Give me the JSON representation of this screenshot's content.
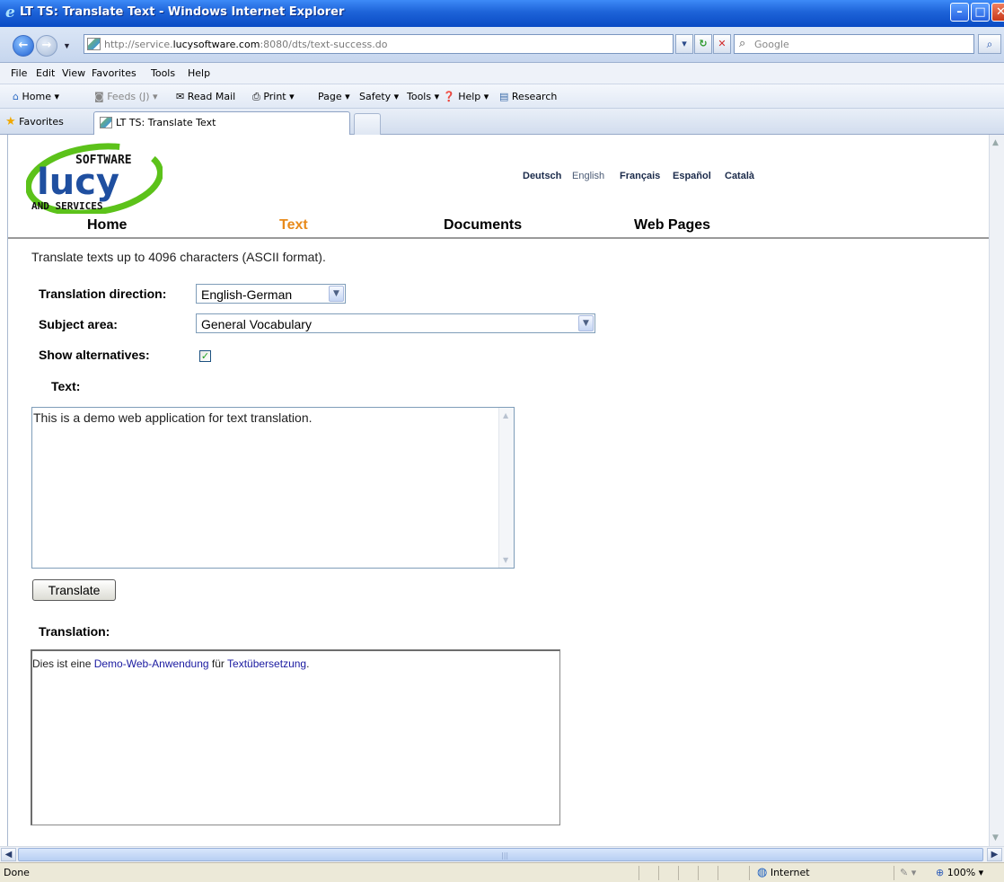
{
  "window": {
    "title": "LT TS: Translate Text - Windows Internet Explorer",
    "min_glyph": "–",
    "max_glyph": "□",
    "close_glyph": "✕"
  },
  "address_bar": {
    "url_prefix": "http://service.",
    "url_domain": "lucysoftware.com",
    "url_suffix": ":8080/dts/text-success.do",
    "search_placeholder": "Google"
  },
  "menu": [
    "File",
    "Edit",
    "View",
    "Favorites",
    "Tools",
    "Help"
  ],
  "command_bar": {
    "home": "Home ▾",
    "feeds": "Feeds (J) ▾",
    "read_mail": "Read Mail",
    "print": "Print ▾",
    "page": "Page ▾",
    "safety": "Safety ▾",
    "tools": "Tools ▾",
    "help": "Help ▾",
    "research": "Research"
  },
  "favorites_bar": {
    "favorites_label": "Favorites",
    "tab_label": "LT TS: Translate Text"
  },
  "site": {
    "logo_top": "SOFTWARE",
    "logo_mid": "lucy",
    "logo_bottom": "AND SERVICES",
    "languages": [
      "Deutsch",
      "English",
      "Français",
      "Español",
      "Català"
    ],
    "nav": [
      "Home",
      "Text",
      "Documents",
      "Web Pages"
    ],
    "active_nav": "Text"
  },
  "form": {
    "intro": "Translate texts up to 4096 characters (ASCII format).",
    "direction_label": "Translation direction:",
    "direction_value": "English-German",
    "subject_label": "Subject area:",
    "subject_value": "General Vocabulary",
    "alternatives_label": "Show alternatives:",
    "alternatives_checked": true,
    "text_label": "Text:",
    "text_value": "This is a demo web application for text translation.",
    "translate_button": "Translate",
    "translation_label": "Translation:",
    "translation_parts": [
      "Dies ist eine ",
      "Demo-Web-Anwendung",
      " für ",
      "Textübersetzung",
      "."
    ]
  },
  "status_bar": {
    "status": "Done",
    "zone": "Internet",
    "zoom": "100%"
  },
  "colors": {
    "title_bar": "#1d63d8",
    "active_nav": "#e88a1a",
    "logo_blue": "#1f4fa0",
    "logo_green": "#5cc21a",
    "alternative_link": "#1a1aa0"
  }
}
